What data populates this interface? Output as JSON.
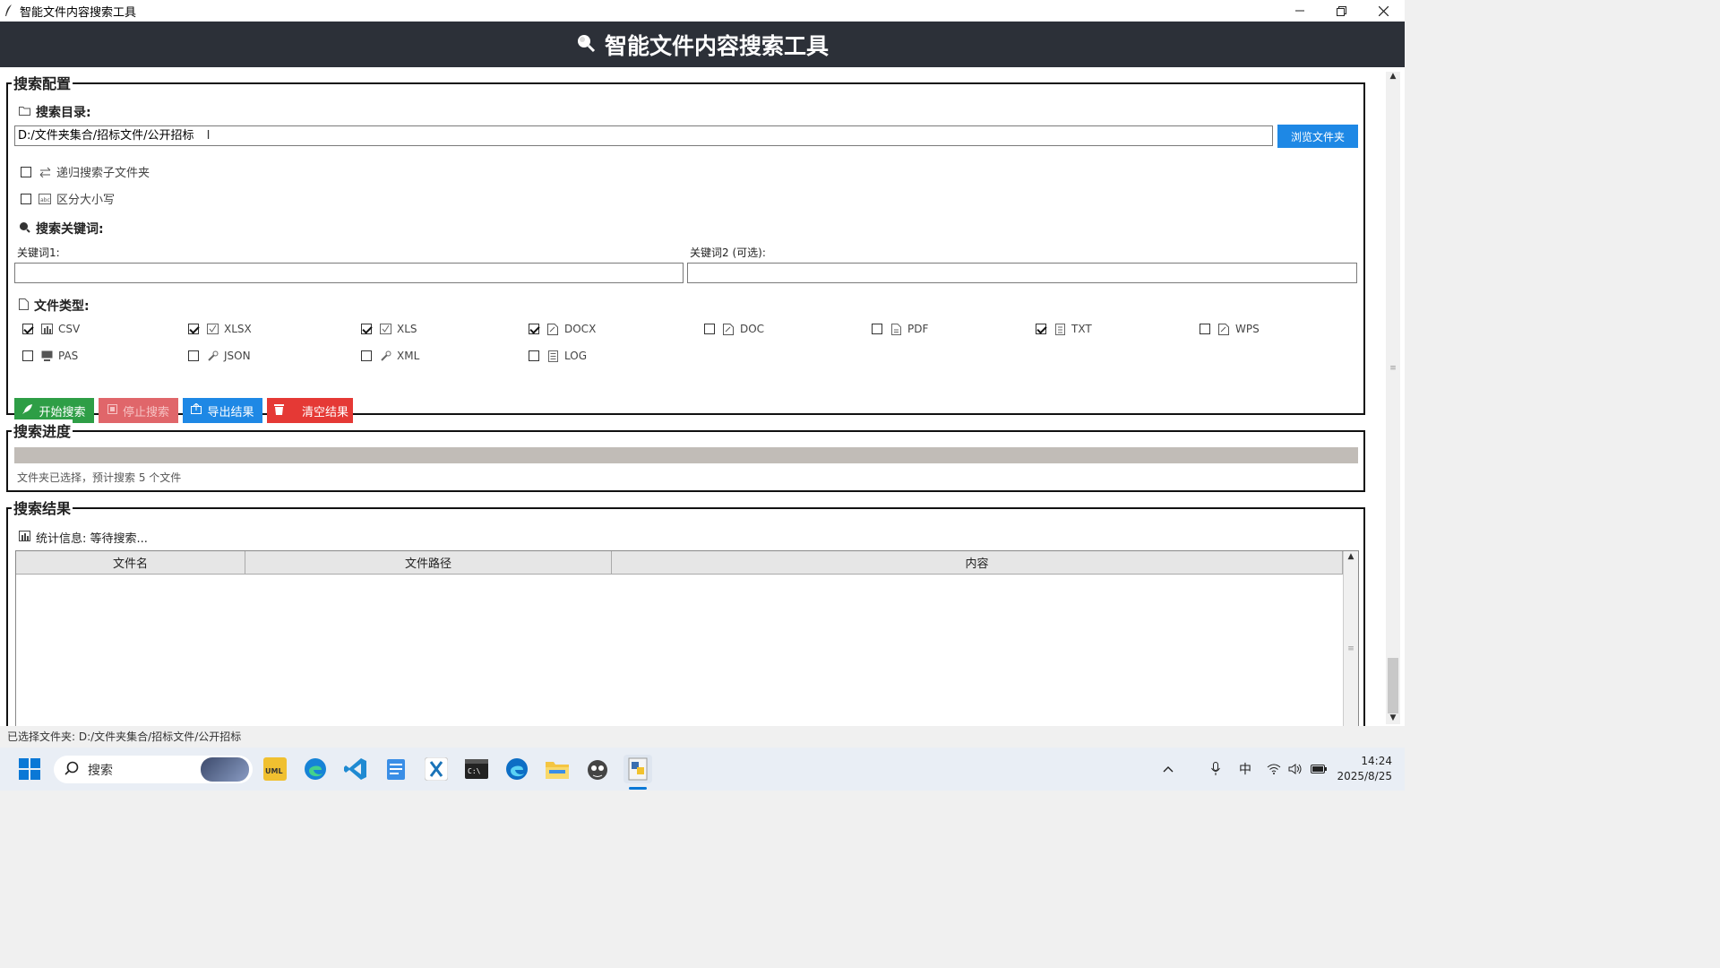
{
  "window": {
    "title": "智能文件内容搜索工具",
    "controls": [
      "—",
      "❐",
      "✕"
    ]
  },
  "banner": {
    "title": "智能文件内容搜索工具"
  },
  "config": {
    "group_title": "搜索配置",
    "dir_label": "搜索目录:",
    "dir_value": "D:/文件夹集合/招标文件/公开招标",
    "browse_label": "浏览文件夹",
    "recursive_label": "递归搜索子文件夹",
    "recursive_checked": false,
    "case_label": "区分大小写",
    "case_checked": false,
    "keywords_label": "搜索关键词:",
    "kw1_label": "关键词1:",
    "kw1_value": "",
    "kw2_label": "关键词2 (可选):",
    "kw2_value": "",
    "types_label": "文件类型:",
    "types": [
      {
        "label": "CSV",
        "checked": true,
        "icon": "chart-icon"
      },
      {
        "label": "XLSX",
        "checked": true,
        "icon": "checkbox-icon"
      },
      {
        "label": "XLS",
        "checked": true,
        "icon": "checkbox-icon"
      },
      {
        "label": "DOCX",
        "checked": true,
        "icon": "memo-icon"
      },
      {
        "label": "DOC",
        "checked": false,
        "icon": "memo-icon"
      },
      {
        "label": "PDF",
        "checked": false,
        "icon": "page-icon"
      },
      {
        "label": "TXT",
        "checked": true,
        "icon": "text-icon"
      },
      {
        "label": "WPS",
        "checked": false,
        "icon": "memo-icon"
      },
      {
        "label": "PAS",
        "checked": false,
        "icon": "computer-icon"
      },
      {
        "label": "JSON",
        "checked": false,
        "icon": "wrench-icon"
      },
      {
        "label": "XML",
        "checked": false,
        "icon": "wrench-icon"
      },
      {
        "label": "LOG",
        "checked": false,
        "icon": "log-icon"
      }
    ],
    "buttons": {
      "start": "开始搜索",
      "stop": "停止搜索",
      "export": "导出结果",
      "clear": "清空结果"
    },
    "colors": {
      "start": "#2e9e46",
      "stop": "#e0666a",
      "export": "#1e88e5",
      "clear": "#e53935"
    }
  },
  "progress": {
    "group_title": "搜索进度",
    "value": 0,
    "status": "文件夹已选择，预计搜索 5 个文件"
  },
  "results": {
    "group_title": "搜索结果",
    "stats": "统计信息: 等待搜索...",
    "columns": [
      "文件名",
      "文件路径",
      "内容"
    ],
    "rows": []
  },
  "statusbar": {
    "text": "已选择文件夹: D:/文件夹集合/招标文件/公开招标"
  },
  "taskbar": {
    "search_placeholder": "搜索",
    "ime": "中",
    "time": "14:24",
    "date": "2025/8/25",
    "apps": [
      "widgets-icon",
      "uml-app-icon",
      "edge-icon",
      "vscode-icon",
      "notepad-icon",
      "xmind-icon",
      "terminal-icon",
      "edge-dev-icon",
      "file-explorer-icon",
      "wechat-dev-icon",
      "python-idle-icon"
    ]
  }
}
